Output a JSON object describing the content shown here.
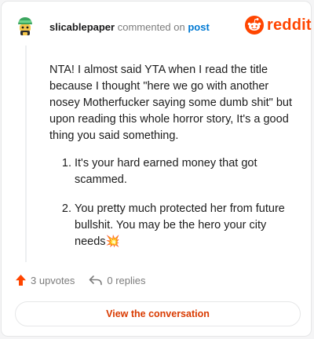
{
  "header": {
    "username": "slicablepaper",
    "action_text": "commented on",
    "post_link": "post"
  },
  "brand": {
    "wordmark": "reddit",
    "color": "#ff4500"
  },
  "comment": {
    "intro": "NTA! I almost said YTA when I read the title because I thought \"here we go with another nosey Motherfucker saying some dumb shit\" but upon reading this whole horror story, It's a good thing you said something.",
    "points": [
      {
        "text": "It's your hard earned money that got scammed."
      },
      {
        "text": "You pretty much protected her from future bullshit. You may be the hero your city needs",
        "emoji": "💥"
      }
    ]
  },
  "footer": {
    "upvotes": "3 upvotes",
    "replies": "0 replies",
    "upvote_icon": "arrow-up-icon",
    "reply_icon": "reply-arrow-icon"
  },
  "cta": {
    "label": "View the conversation"
  },
  "colors": {
    "accent": "#d93a00",
    "link": "#0079d3",
    "upvote": "#ff4500"
  }
}
